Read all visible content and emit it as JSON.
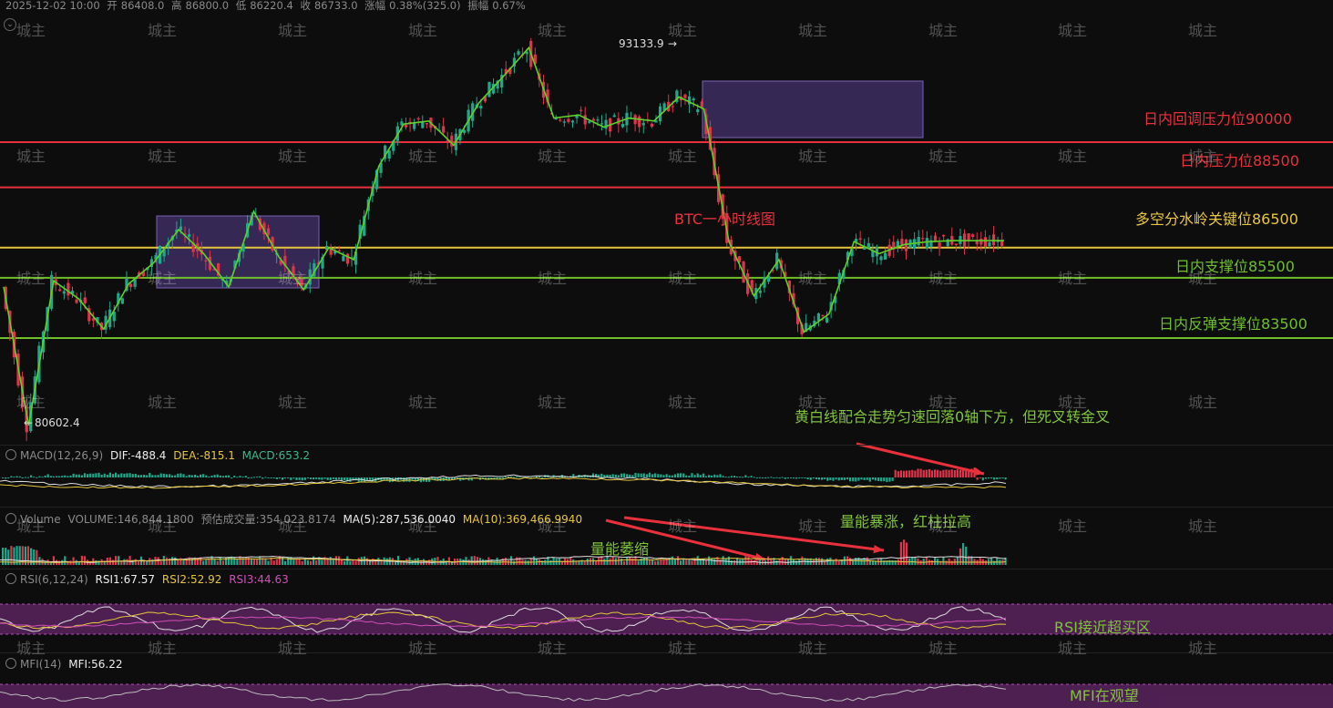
{
  "header": {
    "datetime": "2025-12-02 10:00",
    "open_label": "开",
    "open": "86408.0",
    "high_label": "高",
    "high": "86800.0",
    "low_label": "低",
    "low": "86220.4",
    "close_label": "收",
    "close": "86733.0",
    "change_label": "涨幅",
    "change": "0.38%(325.0)",
    "amplitude_label": "振幅",
    "amplitude": "0.67%"
  },
  "price_labels": {
    "high": "93133.9",
    "low": "80602.4"
  },
  "levels": [
    {
      "label": "日内回调压力位90000",
      "price": 90000,
      "color": "#e8313c"
    },
    {
      "label": "日内压力位88500",
      "price": 88500,
      "color": "#e8313c"
    },
    {
      "label": "多空分水岭关键位86500",
      "price": 86500,
      "color": "#e6c63c"
    },
    {
      "label": "日内支撑位85500",
      "price": 85500,
      "color": "#6fbf2a"
    },
    {
      "label": "日内反弹支撑位83500",
      "price": 83500,
      "color": "#6fbf2a"
    }
  ],
  "chart_title": "BTC一小时线图",
  "annotations": {
    "macd_note": "黄白线配合走势匀速回落0轴下方，但死叉转金叉",
    "volume_shrink": "量能萎缩",
    "volume_surge": "量能暴涨，红柱拉高",
    "rsi_note": "RSI接近超买区",
    "mfi_note": "MFI在观望"
  },
  "macd": {
    "name": "MACD(12,26,9)",
    "dif": "DIF:-488.4",
    "dea": "DEA:-815.1",
    "macd": "MACD:653.2"
  },
  "volume": {
    "name": "Volume",
    "vol": "VOLUME:146,844.1800",
    "est": "预估成交量:354,023.8174",
    "ma5": "MA(5):287,536.0040",
    "ma10": "MA(10):369,466.9940"
  },
  "rsi": {
    "name": "RSI(6,12,24)",
    "rsi1": "RSI1:67.57",
    "rsi2": "RSI2:52.92",
    "rsi3": "RSI3:44.63"
  },
  "mfi": {
    "name": "MFI(14)",
    "mfi": "MFI:56.22"
  },
  "watermark": "城主",
  "colors": {
    "up": "#1fa88a",
    "down": "#e0344a",
    "zigzag": "#5fd02a",
    "box": "#5a3f8f"
  },
  "chart_data": {
    "type": "candlestick",
    "title": "BTC一小时线图",
    "ylim": [
      79000,
      94500
    ],
    "x": [
      "c0",
      "c1",
      "c2",
      "c3",
      "c4",
      "c5",
      "c6",
      "c7",
      "c8",
      "c9",
      "c10",
      "c11",
      "c12",
      "c13",
      "c14",
      "c15",
      "c16",
      "c17",
      "c18",
      "c19",
      "c20",
      "c21",
      "c22",
      "c23",
      "c24",
      "c25",
      "c26",
      "c27",
      "c28",
      "c29",
      "c30",
      "c31",
      "c32",
      "c33",
      "c34",
      "c35",
      "c36",
      "c37",
      "c38",
      "c39",
      "c40"
    ],
    "series": [
      {
        "close": [
          85200,
          80602,
          85400,
          84800,
          83800,
          85300,
          86000,
          87100,
          86300,
          85200,
          87700,
          86200,
          85100,
          86500,
          86100,
          89200,
          90600,
          90700,
          89900,
          91300,
          92200,
          93134,
          90800,
          90900,
          90500,
          90800,
          90700,
          91500,
          91100,
          86700,
          84900,
          86100,
          83700,
          84300,
          86700,
          86300,
          86600,
          86700,
          86733,
          86733,
          86733
        ]
      }
    ],
    "levels": [
      90000,
      88500,
      86500,
      85500,
      83500
    ]
  }
}
